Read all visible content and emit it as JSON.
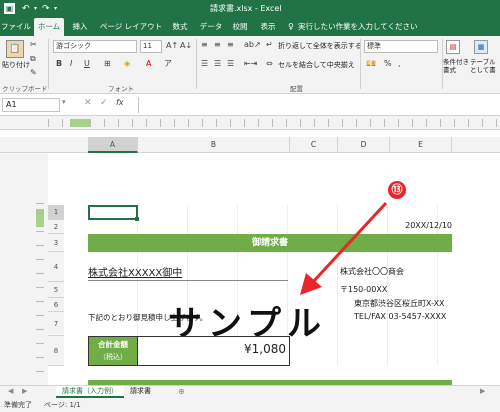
{
  "titlebar": {
    "title": "請求書.xlsx - Excel"
  },
  "tabs": [
    {
      "label": "ファイル"
    },
    {
      "label": "ホーム"
    },
    {
      "label": "挿入"
    },
    {
      "label": "ページ レイアウト"
    },
    {
      "label": "数式"
    },
    {
      "label": "データ"
    },
    {
      "label": "校閲"
    },
    {
      "label": "表示"
    }
  ],
  "tell_me": {
    "placeholder": "実行したい作業を入力してください"
  },
  "ribbon": {
    "paste_label": "貼り付け",
    "clipboard_label": "クリップボード",
    "font_name": "游ゴシック",
    "font_size": "11",
    "font_group_label": "フォント",
    "wrap_text_label": "折り返して全体を表示する",
    "merge_label": "セルを結合して中央揃え",
    "alignment_group_label": "配置",
    "number_format": "標準",
    "cond_format_label": "条件付き書式",
    "table_format_label": "テーブルとして書式設定"
  },
  "formulabar": {
    "namebox": "A1",
    "fx": "fx"
  },
  "columns": [
    "A",
    "B",
    "C",
    "D",
    "E"
  ],
  "rows": [
    "1",
    "2",
    "3",
    "4",
    "5",
    "6",
    "7",
    "8"
  ],
  "sheet": {
    "date": "20XX/12/10",
    "title": "御請求書",
    "client": "株式会社XXXXX御中",
    "company": "株式会社〇〇商会",
    "postal": "〒150-00XX",
    "address": "東京都渋谷区桜丘町X-XX",
    "telfax": "TEL/FAX 03-5457-XXXX",
    "note": "下記のとおり御見積申し上げます。",
    "total_label": "合計金額",
    "total_sub": "（税込）",
    "total_value": "¥1,080",
    "watermark": "サンプル"
  },
  "annotation": {
    "number": "⑬",
    "color": "#e8262b"
  },
  "sheet_tabs": [
    {
      "label": "請求書（入力例）",
      "active": true
    },
    {
      "label": "請求書",
      "active": false
    }
  ],
  "status": {
    "ready": "準備完了",
    "page": "ページ: 1/1"
  },
  "colors": {
    "excel_green": "#217346",
    "header_fill": "#70ad47",
    "total_fill": "#70ad47"
  }
}
